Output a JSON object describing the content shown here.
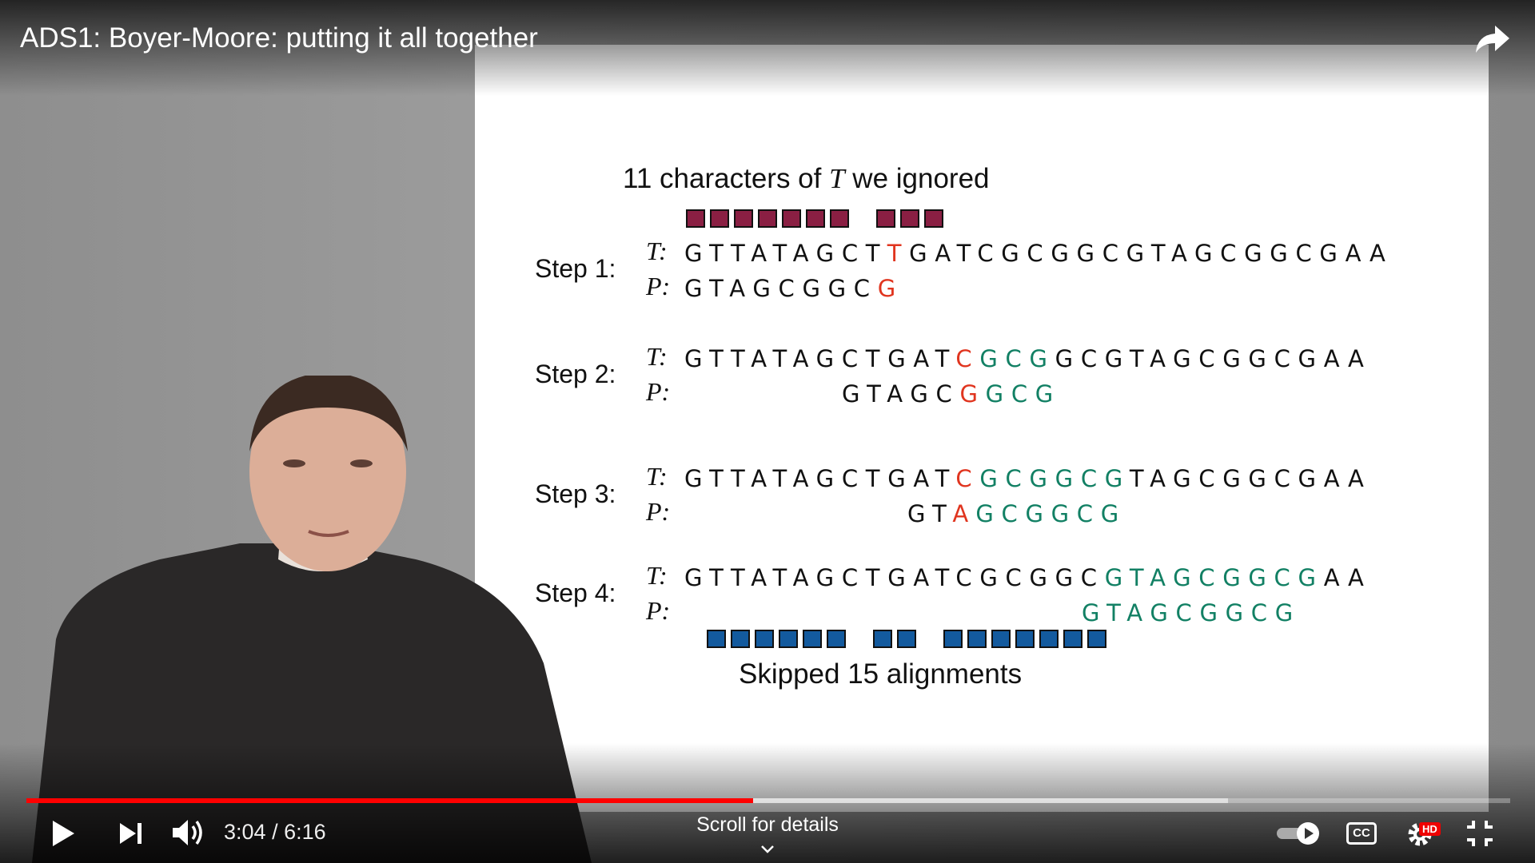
{
  "video": {
    "title": "ADS1: Boyer-Moore: putting it all together",
    "current_time": "3:04",
    "duration": "6:16",
    "time_separator": "/",
    "progress_played": 0.49,
    "progress_buffered": 0.81,
    "scroll_hint": "Scroll for details"
  },
  "slide": {
    "heading_top_pre": "11 characters of ",
    "heading_top_var": "T",
    "heading_top_post": " we ignored",
    "heading_bottom": "Skipped 15 alignments",
    "t_label": "T:",
    "p_label": "P:",
    "steps": [
      {
        "label": "Step 1:",
        "t": [
          {
            "t": "GTTATAGCT",
            "c": ""
          },
          {
            "t": "T",
            "c": "red"
          },
          {
            "t": "GATCGCGGCGTAGCGGCGAA",
            "c": ""
          }
        ],
        "p": [
          {
            "t": "GTAGCGGC",
            "c": ""
          },
          {
            "t": "G",
            "c": "red"
          }
        ]
      },
      {
        "label": "Step 2:",
        "t": [
          {
            "t": "GTTATAGCTGAT",
            "c": ""
          },
          {
            "t": "C",
            "c": "red"
          },
          {
            "t": "GCG",
            "c": "green"
          },
          {
            "t": "GCGTAGCGGCGAA",
            "c": ""
          }
        ],
        "p": [
          {
            "t": "GTAGC",
            "c": ""
          },
          {
            "t": "G",
            "c": "red"
          },
          {
            "t": "GCG",
            "c": "green"
          }
        ]
      },
      {
        "label": "Step 3:",
        "t": [
          {
            "t": "GTTATAGCTGAT",
            "c": ""
          },
          {
            "t": "C",
            "c": "red"
          },
          {
            "t": "GCGGCG",
            "c": "green"
          },
          {
            "t": "TAGCGGCGAA",
            "c": ""
          }
        ],
        "p": [
          {
            "t": "GT",
            "c": ""
          },
          {
            "t": "A",
            "c": "red"
          },
          {
            "t": "GCGGCG",
            "c": "green"
          }
        ]
      },
      {
        "label": "Step 4:",
        "t": [
          {
            "t": "GTTATAGCTGATCGCGGC",
            "c": ""
          },
          {
            "t": "GTAGCGGCG",
            "c": "green"
          },
          {
            "t": "AA",
            "c": ""
          }
        ],
        "p": [
          {
            "t": "GTAGCGGCG",
            "c": "green"
          }
        ]
      }
    ],
    "ignored_box_groups": [
      7,
      3
    ],
    "skipped_box_groups": [
      6,
      2,
      7
    ]
  },
  "controls": {
    "play_icon": "play-icon",
    "next_icon": "next-icon",
    "volume_icon": "volume-icon",
    "autoplay_icon": "autoplay-toggle-icon",
    "cc_label": "CC",
    "hd_label": "HD",
    "settings_icon": "gear-icon",
    "exit_fullscreen_icon": "exit-fullscreen-icon"
  },
  "colors": {
    "progress": "#ff0000",
    "mismatch": "#e0351f",
    "match": "#128064",
    "ignored_box": "#8a1f43",
    "skipped_box": "#135a9e"
  }
}
